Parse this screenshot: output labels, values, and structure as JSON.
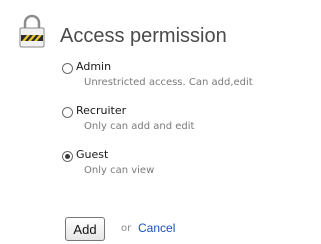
{
  "header": {
    "title": "Access permission",
    "icon": "padlock-icon"
  },
  "options": [
    {
      "label": "Admin",
      "description": "Unrestricted access. Can add,edit",
      "selected": false
    },
    {
      "label": "Recruiter",
      "description": "Only can add and edit",
      "selected": false
    },
    {
      "label": "Guest",
      "description": "Only can view",
      "selected": true
    }
  ],
  "actions": {
    "add_label": "Add",
    "or_text": "or",
    "cancel_label": "Cancel"
  },
  "colors": {
    "link": "#1f4fb5",
    "title": "#4a4a4a",
    "description": "#7a7a7a"
  }
}
